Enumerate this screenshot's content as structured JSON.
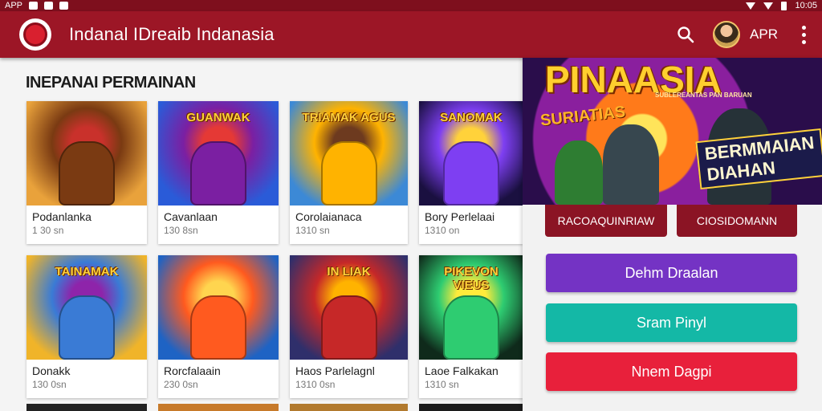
{
  "status_bar": {
    "left_text": "APP",
    "right_text": "10:05"
  },
  "app_bar": {
    "title": "Indanal IDreaib Indanasia",
    "user_label": "APR",
    "icons": [
      "app-logo-icon",
      "search-icon",
      "avatar",
      "more-vert-icon"
    ]
  },
  "section": {
    "title": "INEPANAI PERMAINAN"
  },
  "games": [
    {
      "name": "Podanlanka",
      "sub": "1 30 sn",
      "art_text": "",
      "palette": [
        "#e9a23b",
        "#7a3a12",
        "#c9312b"
      ]
    },
    {
      "name": "Cavanlaan",
      "sub": "130 8sn",
      "art_text": "GUANWAK",
      "palette": [
        "#2a5bd8",
        "#7b1fa2",
        "#e53935"
      ]
    },
    {
      "name": "Corolaianaca",
      "sub": "1310 sn",
      "art_text": "TRIAMAK AGUS",
      "palette": [
        "#3c89d6",
        "#ffb300",
        "#6d3a1f"
      ]
    },
    {
      "name": "Bory Perlelaai",
      "sub": "1310 on",
      "art_text": "SANOMAK",
      "palette": [
        "#1a1040",
        "#7e3ff2",
        "#ffd23a"
      ]
    },
    {
      "name": "Donakk",
      "sub": "130 0sn",
      "art_text": "TAINAMAK",
      "palette": [
        "#f0b429",
        "#3a7bd5",
        "#8e24aa"
      ]
    },
    {
      "name": "Rorcfalaain",
      "sub": "230 0sn",
      "art_text": "",
      "palette": [
        "#1e63c4",
        "#ff5a1f",
        "#ffd54f"
      ]
    },
    {
      "name": "Haos Parlelagnl",
      "sub": "1310 0sn",
      "art_text": "IN LIAK",
      "palette": [
        "#2f2f6b",
        "#c62828",
        "#ffb300"
      ]
    },
    {
      "name": "Laoe Falkakan",
      "sub": "1310 sn",
      "art_text": "PIKEVON VIEUS",
      "palette": [
        "#0f2a1b",
        "#2ecc71",
        "#ffeb3b"
      ]
    }
  ],
  "panel": {
    "banner_title": "PINAASIA",
    "banner_tagline": "SUBLEREANTAS PAN BARUAN",
    "banner_sub1": "SURIATIAS",
    "banner_sub2": "BERMMAIAN DIAHAN",
    "tabs": [
      "RACOAQUINRIAW",
      "CIOSIDOMANN"
    ],
    "buttons": [
      {
        "label": "Dehm Draalan",
        "color": "#7433c4"
      },
      {
        "label": "Sram Pinyl",
        "color": "#14b8a6"
      },
      {
        "label": "Nnem Dagpi",
        "color": "#e8203b"
      }
    ]
  },
  "colors": {
    "app_bar": "#9c1626",
    "status_bar": "#7e0f1d",
    "tab": "#8b1424"
  }
}
